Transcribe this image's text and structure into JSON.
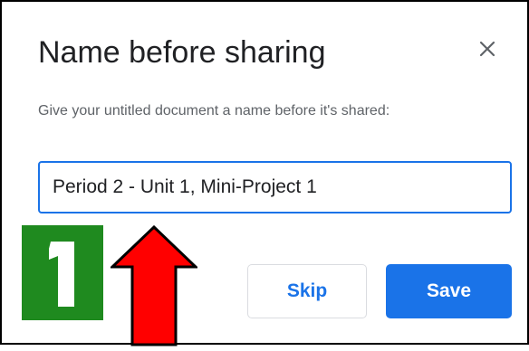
{
  "dialog": {
    "title": "Name before sharing",
    "subtitle": "Give your untitled document a name before it's shared:",
    "close_icon": "close-icon",
    "name_field": {
      "value": "Period 2 - Unit 1, Mini-Project 1"
    },
    "skip_label": "Skip",
    "save_label": "Save"
  },
  "annotation": {
    "step_number": "1",
    "badge_color": "#1f8a1f",
    "arrow_color": "#ff0000",
    "arrow_icon": "up-arrow-icon"
  },
  "colors": {
    "accent": "#1a73e8",
    "title_text": "#202124",
    "secondary_text": "#5f6368"
  }
}
